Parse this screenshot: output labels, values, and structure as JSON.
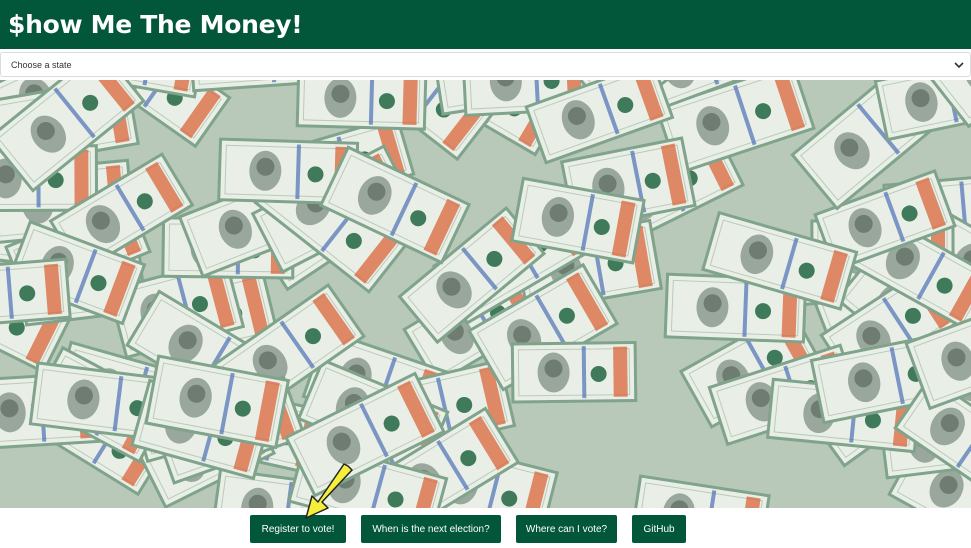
{
  "header": {
    "title": "$how Me The Money!"
  },
  "state_select": {
    "selected": "Choose a state"
  },
  "hero": {
    "icon": "hundred-dollar-bills-background"
  },
  "actions": {
    "register_label": "Register to vote!",
    "election_label": "When is the next election?",
    "where_label": "Where can I vote?",
    "github_label": "GitHub"
  },
  "colors": {
    "brand_green": "#02573a",
    "bill_light": "#e9efe6",
    "bill_green": "#7fa38b",
    "bill_seal": "#3f7a5a",
    "bill_orange": "#d9653b",
    "bill_blue": "#4b6fb5",
    "arrow_yellow": "#f5ee3b"
  }
}
